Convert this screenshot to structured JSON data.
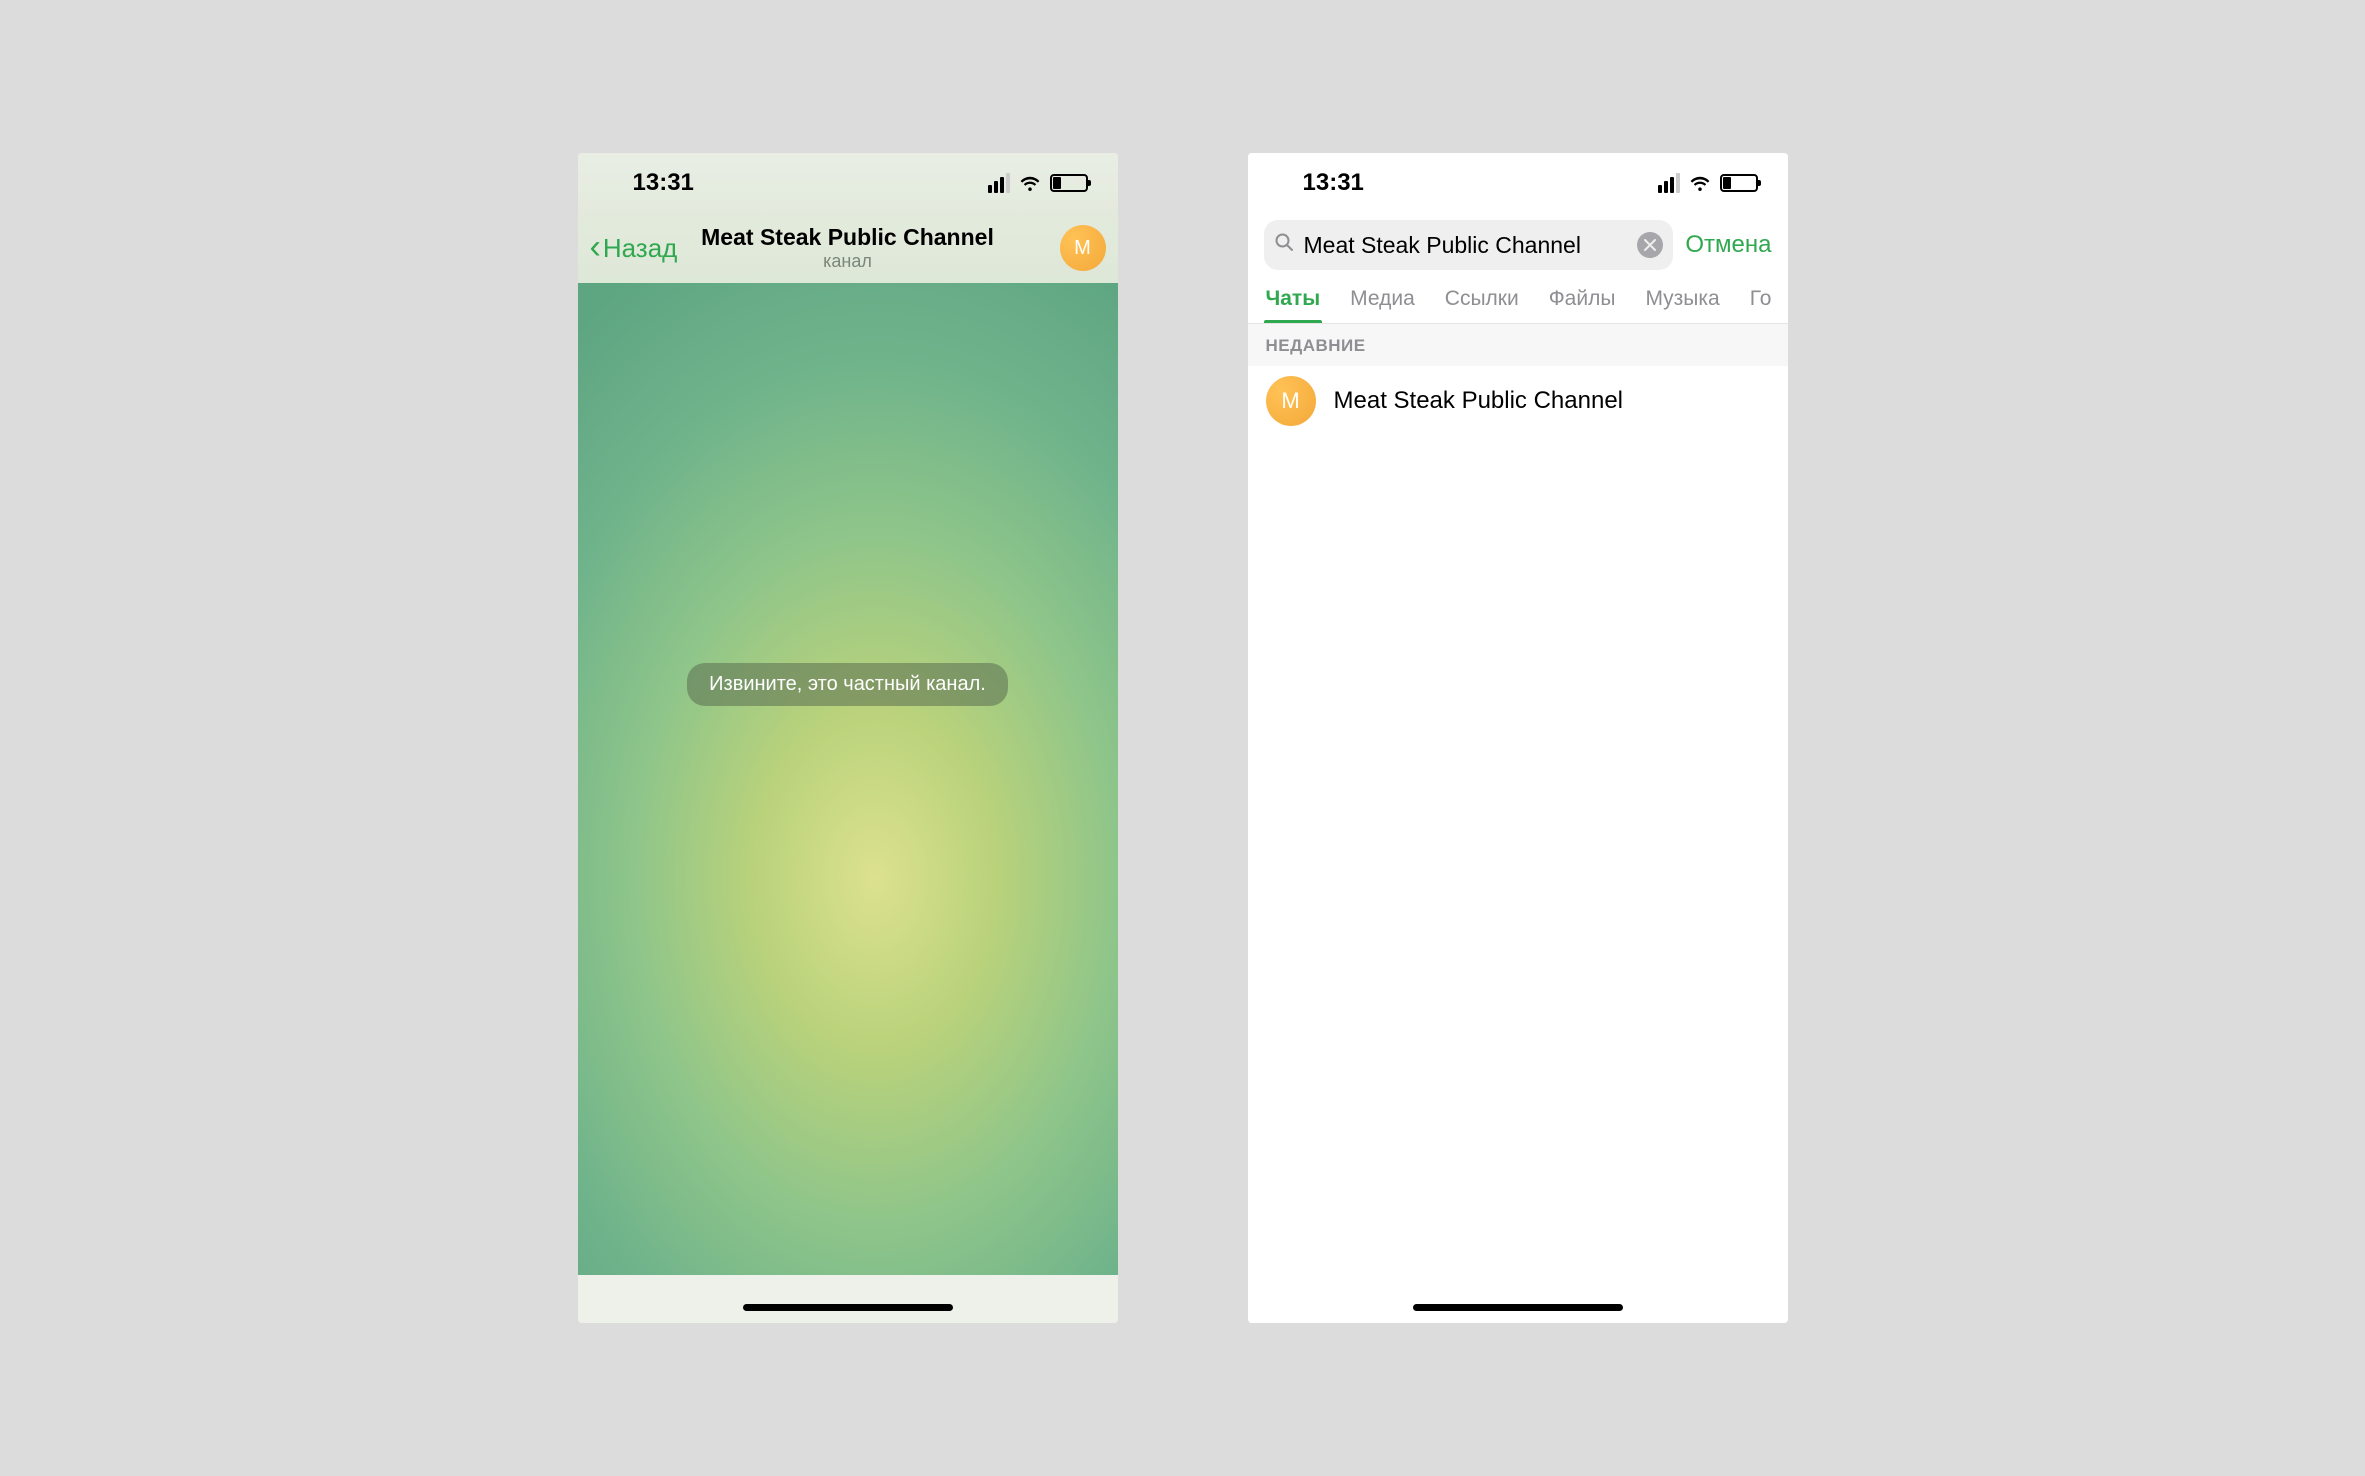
{
  "status": {
    "time": "13:31"
  },
  "left": {
    "back_label": "Назад",
    "title": "Meat Steak Public Channel",
    "subtitle": "канал",
    "avatar_letter": "M",
    "private_notice": "Извините, это частный канал."
  },
  "right": {
    "search_value": "Meat Steak Public Channel",
    "cancel_label": "Отмена",
    "tabs": [
      "Чаты",
      "Медиа",
      "Ссылки",
      "Файлы",
      "Музыка",
      "Го"
    ],
    "active_tab_index": 0,
    "section_label": "НЕДАВНИЕ",
    "result": {
      "avatar_letter": "M",
      "title": "Meat Steak Public Channel"
    }
  }
}
